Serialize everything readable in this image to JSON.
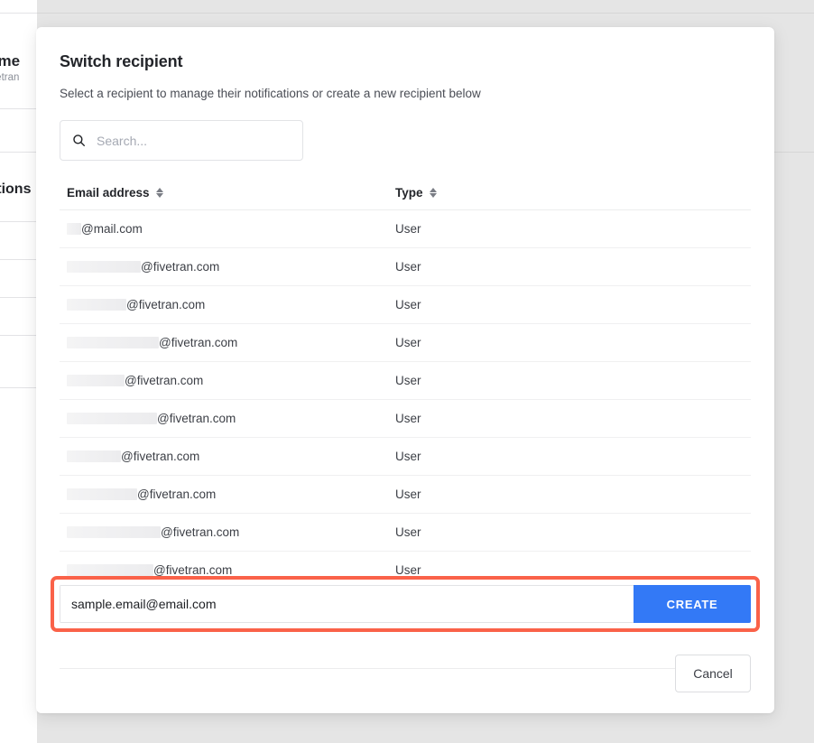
{
  "background": {
    "account_name_fragment": "tname",
    "account_email_fragment": "@fivetran",
    "nav_item_fragment": "ons",
    "section_heading_fragment": "scriptions"
  },
  "modal": {
    "title": "Switch recipient",
    "subtitle": "Select a recipient to manage their notifications or create a new recipient below",
    "search": {
      "placeholder": "Search...",
      "value": "",
      "icon": "search-icon"
    },
    "table": {
      "columns": [
        {
          "label": "Email address",
          "sortable": true,
          "sort_icon": "sort-arrows-icon"
        },
        {
          "label": "Type",
          "sortable": true,
          "sort_icon": "sort-arrows-icon"
        }
      ],
      "rows": [
        {
          "redacted_width": 16,
          "email_suffix": "@mail.com",
          "type": "User"
        },
        {
          "redacted_width": 82,
          "email_suffix": "@fivetran.com",
          "type": "User"
        },
        {
          "redacted_width": 66,
          "email_suffix": "@fivetran.com",
          "type": "User"
        },
        {
          "redacted_width": 102,
          "email_suffix": "@fivetran.com",
          "type": "User"
        },
        {
          "redacted_width": 64,
          "email_suffix": "@fivetran.com",
          "type": "User"
        },
        {
          "redacted_width": 100,
          "email_suffix": "@fivetran.com",
          "type": "User"
        },
        {
          "redacted_width": 60,
          "email_suffix": "@fivetran.com",
          "type": "User"
        },
        {
          "redacted_width": 78,
          "email_suffix": "@fivetran.com",
          "type": "User"
        },
        {
          "redacted_width": 104,
          "email_suffix": "@fivetran.com",
          "type": "User"
        },
        {
          "redacted_width": 96,
          "email_suffix": "@fivetran.com",
          "type": "User"
        }
      ]
    },
    "create": {
      "input_value": "sample.email@email.com",
      "input_placeholder": "",
      "button_label": "CREATE",
      "highlighted": true,
      "highlight_color": "#fa6249",
      "button_color": "#3379f6"
    },
    "footer": {
      "cancel_label": "Cancel"
    }
  }
}
